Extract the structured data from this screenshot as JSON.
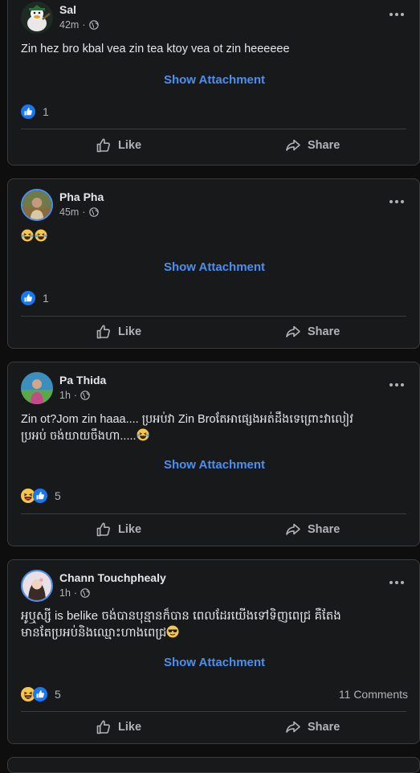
{
  "posts": [
    {
      "author": "Sal",
      "time": "42m",
      "privacy_separator": "·",
      "text": "Zin hez bro kbal vea zin tea ktoy vea ot zin heeeeee",
      "attachment_label": "Show Attachment",
      "reaction_count": "1",
      "reactions": [
        "like"
      ],
      "comments": "",
      "like_label": "Like",
      "share_label": "Share"
    },
    {
      "author": "Pha Pha",
      "time": "45m",
      "privacy_separator": "·",
      "text": "",
      "emojis": [
        "laughing-tears",
        "laughing-tears"
      ],
      "attachment_label": "Show Attachment",
      "reaction_count": "1",
      "reactions": [
        "like"
      ],
      "comments": "",
      "like_label": "Like",
      "share_label": "Share"
    },
    {
      "author": "Pa Thida",
      "time": "1h",
      "privacy_separator": "·",
      "text_line1": "Zin ot?Jom zin haaa.... ប្រអប់វា Zin Broតែអាផ្សេងអត់ដឹងទេព្រោះវាលៀវ",
      "text_line2": "ប្រអប់ ចង់យាយចឹងហា.....",
      "attachment_label": "Show Attachment",
      "reaction_count": "5",
      "reactions": [
        "haha",
        "like"
      ],
      "comments": "",
      "like_label": "Like",
      "share_label": "Share"
    },
    {
      "author": "Chann Touchphealy",
      "time": "1h",
      "privacy_separator": "·",
      "text_line1": "អូឬស្សី is belike ចង់បានបុន្មានក៏បាន ពេលដែរយើងទៅទិញពេជ្រ គឺតែង",
      "text_line2": "មានតែប្រអប់និងឈ្មោះហាងពេជ្រ",
      "attachment_label": "Show Attachment",
      "reaction_count": "5",
      "reactions": [
        "haha",
        "like"
      ],
      "comments": "11 Comments",
      "like_label": "Like",
      "share_label": "Share"
    }
  ],
  "colors": {
    "background": "#0e0e0f",
    "card": "#18191a",
    "border": "#3a3b3c",
    "link": "#4b8ff0",
    "muted": "#b0b3b8",
    "like_blue": "#1877f2",
    "haha_yellow": "#f7c64b"
  }
}
